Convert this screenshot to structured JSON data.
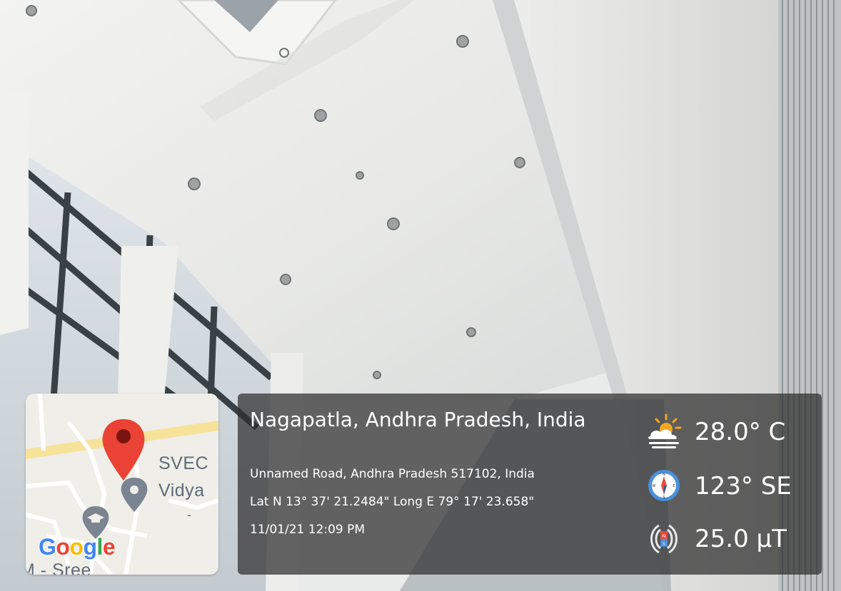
{
  "overlay": {
    "place_title": "Nagapatla, Andhra Pradesh, India",
    "address": "Unnamed Road, Andhra Pradesh 517102, India",
    "coordinates": "Lat N 13° 37' 21.2484\" Long E 79° 17' 23.658\"",
    "datetime": "11/01/21 12:09 PM",
    "temperature": "28.0° C",
    "heading": "123° SE",
    "magnetic_field": "25.0 µT"
  },
  "map_thumbnail": {
    "labels": [
      "SVEC",
      "Vidya",
      "M - Sree",
      "-"
    ],
    "logo_text": "Google",
    "logo_colors": [
      "#4285F4",
      "#EA4335",
      "#FBBC05",
      "#4285F4",
      "#34A853",
      "#EA4335"
    ]
  },
  "icons": {
    "weather": "partly-sunny-icon",
    "compass": "compass-icon",
    "magnetometer": "magnet-field-icon",
    "pin": "map-pin-icon",
    "place": "place-marker-icon",
    "school": "school-icon"
  },
  "colors": {
    "panel_bg": "#2d2d2d",
    "pin_red": "#EA4335",
    "map_bg": "#efeee8"
  }
}
